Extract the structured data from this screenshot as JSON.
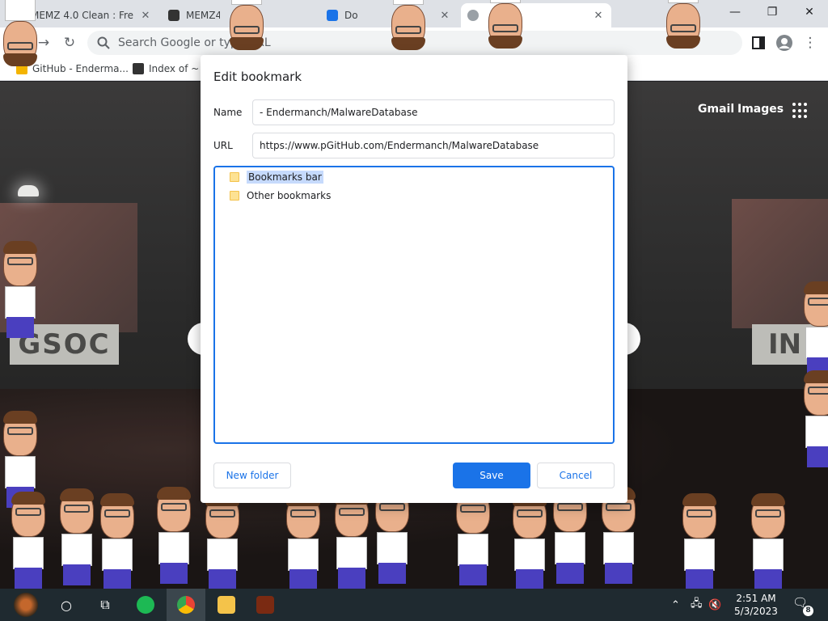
{
  "browser": {
    "tabs": [
      {
        "title": "MEMZ 4.0 Clean : Fre",
        "close": "✕"
      },
      {
        "title": "MEMZ4",
        "close": ""
      },
      {
        "title": "Do",
        "close": "✕"
      },
      {
        "title": "",
        "close": "✕"
      }
    ],
    "window_controls": {
      "minimize": "—",
      "maximize": "❐",
      "close": "✕"
    },
    "omnibox_placeholder": "Search Google or type URL",
    "bookmarks": [
      {
        "label": "GitHub - Enderma..."
      },
      {
        "label": "Index of ~"
      }
    ]
  },
  "ntp": {
    "gmail": "Gmail",
    "images": "Images",
    "sign_left": "GSOC",
    "sign_right": "IN"
  },
  "dialog": {
    "title": "Edit bookmark",
    "name_label": "Name",
    "name_value": "- Endermanch/MalwareDatabase",
    "url_label": "URL",
    "url_value": "https://www.pGitHub.com/Endermanch/MalwareDatabase",
    "folders": [
      "Bookmarks bar",
      "Other bookmarks"
    ],
    "selected_folder": "Bookmarks bar",
    "new_folder": "New folder",
    "save": "Save",
    "cancel": "Cancel"
  },
  "taskbar": {
    "time": "2:51 AM",
    "date": "5/3/2023",
    "notifications": "8"
  },
  "colors": {
    "accent": "#1a73e8",
    "selection": "#c6dafc",
    "taskbar": "#1f2a30"
  }
}
